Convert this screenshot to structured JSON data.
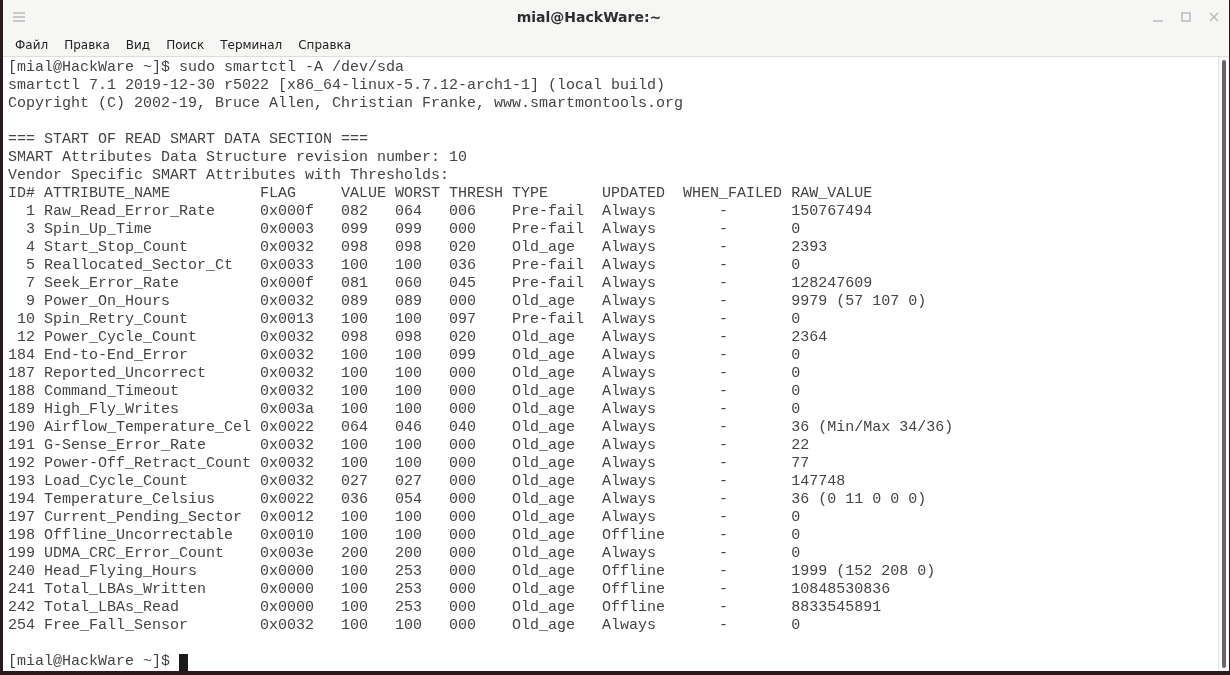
{
  "window": {
    "title": "mial@HackWare:~"
  },
  "menu": [
    "Файл",
    "Правка",
    "Вид",
    "Поиск",
    "Терминал",
    "Справка"
  ],
  "terminal": {
    "blocks": [
      [
        "[mial@HackWare ~]$ sudo smartctl -A /dev/sda",
        "smartctl 7.1 2019-12-30 r5022 [x86_64-linux-5.7.12-arch1-1] (local build)",
        "Copyright (C) 2002-19, Bruce Allen, Christian Franke, www.smartmontools.org"
      ],
      [
        "=== START OF READ SMART DATA SECTION ===",
        "SMART Attributes Data Structure revision number: 10",
        "Vendor Specific SMART Attributes with Thresholds:",
        "ID# ATTRIBUTE_NAME          FLAG     VALUE WORST THRESH TYPE      UPDATED  WHEN_FAILED RAW_VALUE",
        "  1 Raw_Read_Error_Rate     0x000f   082   064   006    Pre-fail  Always       -       150767494",
        "  3 Spin_Up_Time            0x0003   099   099   000    Pre-fail  Always       -       0",
        "  4 Start_Stop_Count        0x0032   098   098   020    Old_age   Always       -       2393",
        "  5 Reallocated_Sector_Ct   0x0033   100   100   036    Pre-fail  Always       -       0",
        "  7 Seek_Error_Rate         0x000f   081   060   045    Pre-fail  Always       -       128247609",
        "  9 Power_On_Hours          0x0032   089   089   000    Old_age   Always       -       9979 (57 107 0)",
        " 10 Spin_Retry_Count        0x0013   100   100   097    Pre-fail  Always       -       0",
        " 12 Power_Cycle_Count       0x0032   098   098   020    Old_age   Always       -       2364",
        "184 End-to-End_Error        0x0032   100   100   099    Old_age   Always       -       0",
        "187 Reported_Uncorrect      0x0032   100   100   000    Old_age   Always       -       0",
        "188 Command_Timeout         0x0032   100   100   000    Old_age   Always       -       0",
        "189 High_Fly_Writes         0x003a   100   100   000    Old_age   Always       -       0",
        "190 Airflow_Temperature_Cel 0x0022   064   046   040    Old_age   Always       -       36 (Min/Max 34/36)",
        "191 G-Sense_Error_Rate      0x0032   100   100   000    Old_age   Always       -       22",
        "192 Power-Off_Retract_Count 0x0032   100   100   000    Old_age   Always       -       77",
        "193 Load_Cycle_Count        0x0032   027   027   000    Old_age   Always       -       147748",
        "194 Temperature_Celsius     0x0022   036   054   000    Old_age   Always       -       36 (0 11 0 0 0)",
        "197 Current_Pending_Sector  0x0012   100   100   000    Old_age   Always       -       0",
        "198 Offline_Uncorrectable   0x0010   100   100   000    Old_age   Offline      -       0",
        "199 UDMA_CRC_Error_Count    0x003e   200   200   000    Old_age   Always       -       0",
        "240 Head_Flying_Hours       0x0000   100   253   000    Old_age   Offline      -       1999 (152 208 0)",
        "241 Total_LBAs_Written      0x0000   100   253   000    Old_age   Offline      -       10848530836",
        "242 Total_LBAs_Read         0x0000   100   253   000    Old_age   Offline      -       8833545891",
        "254 Free_Fall_Sensor        0x0032   100   100   000    Old_age   Always       -       0"
      ]
    ],
    "prompt": "[mial@HackWare ~]$"
  }
}
